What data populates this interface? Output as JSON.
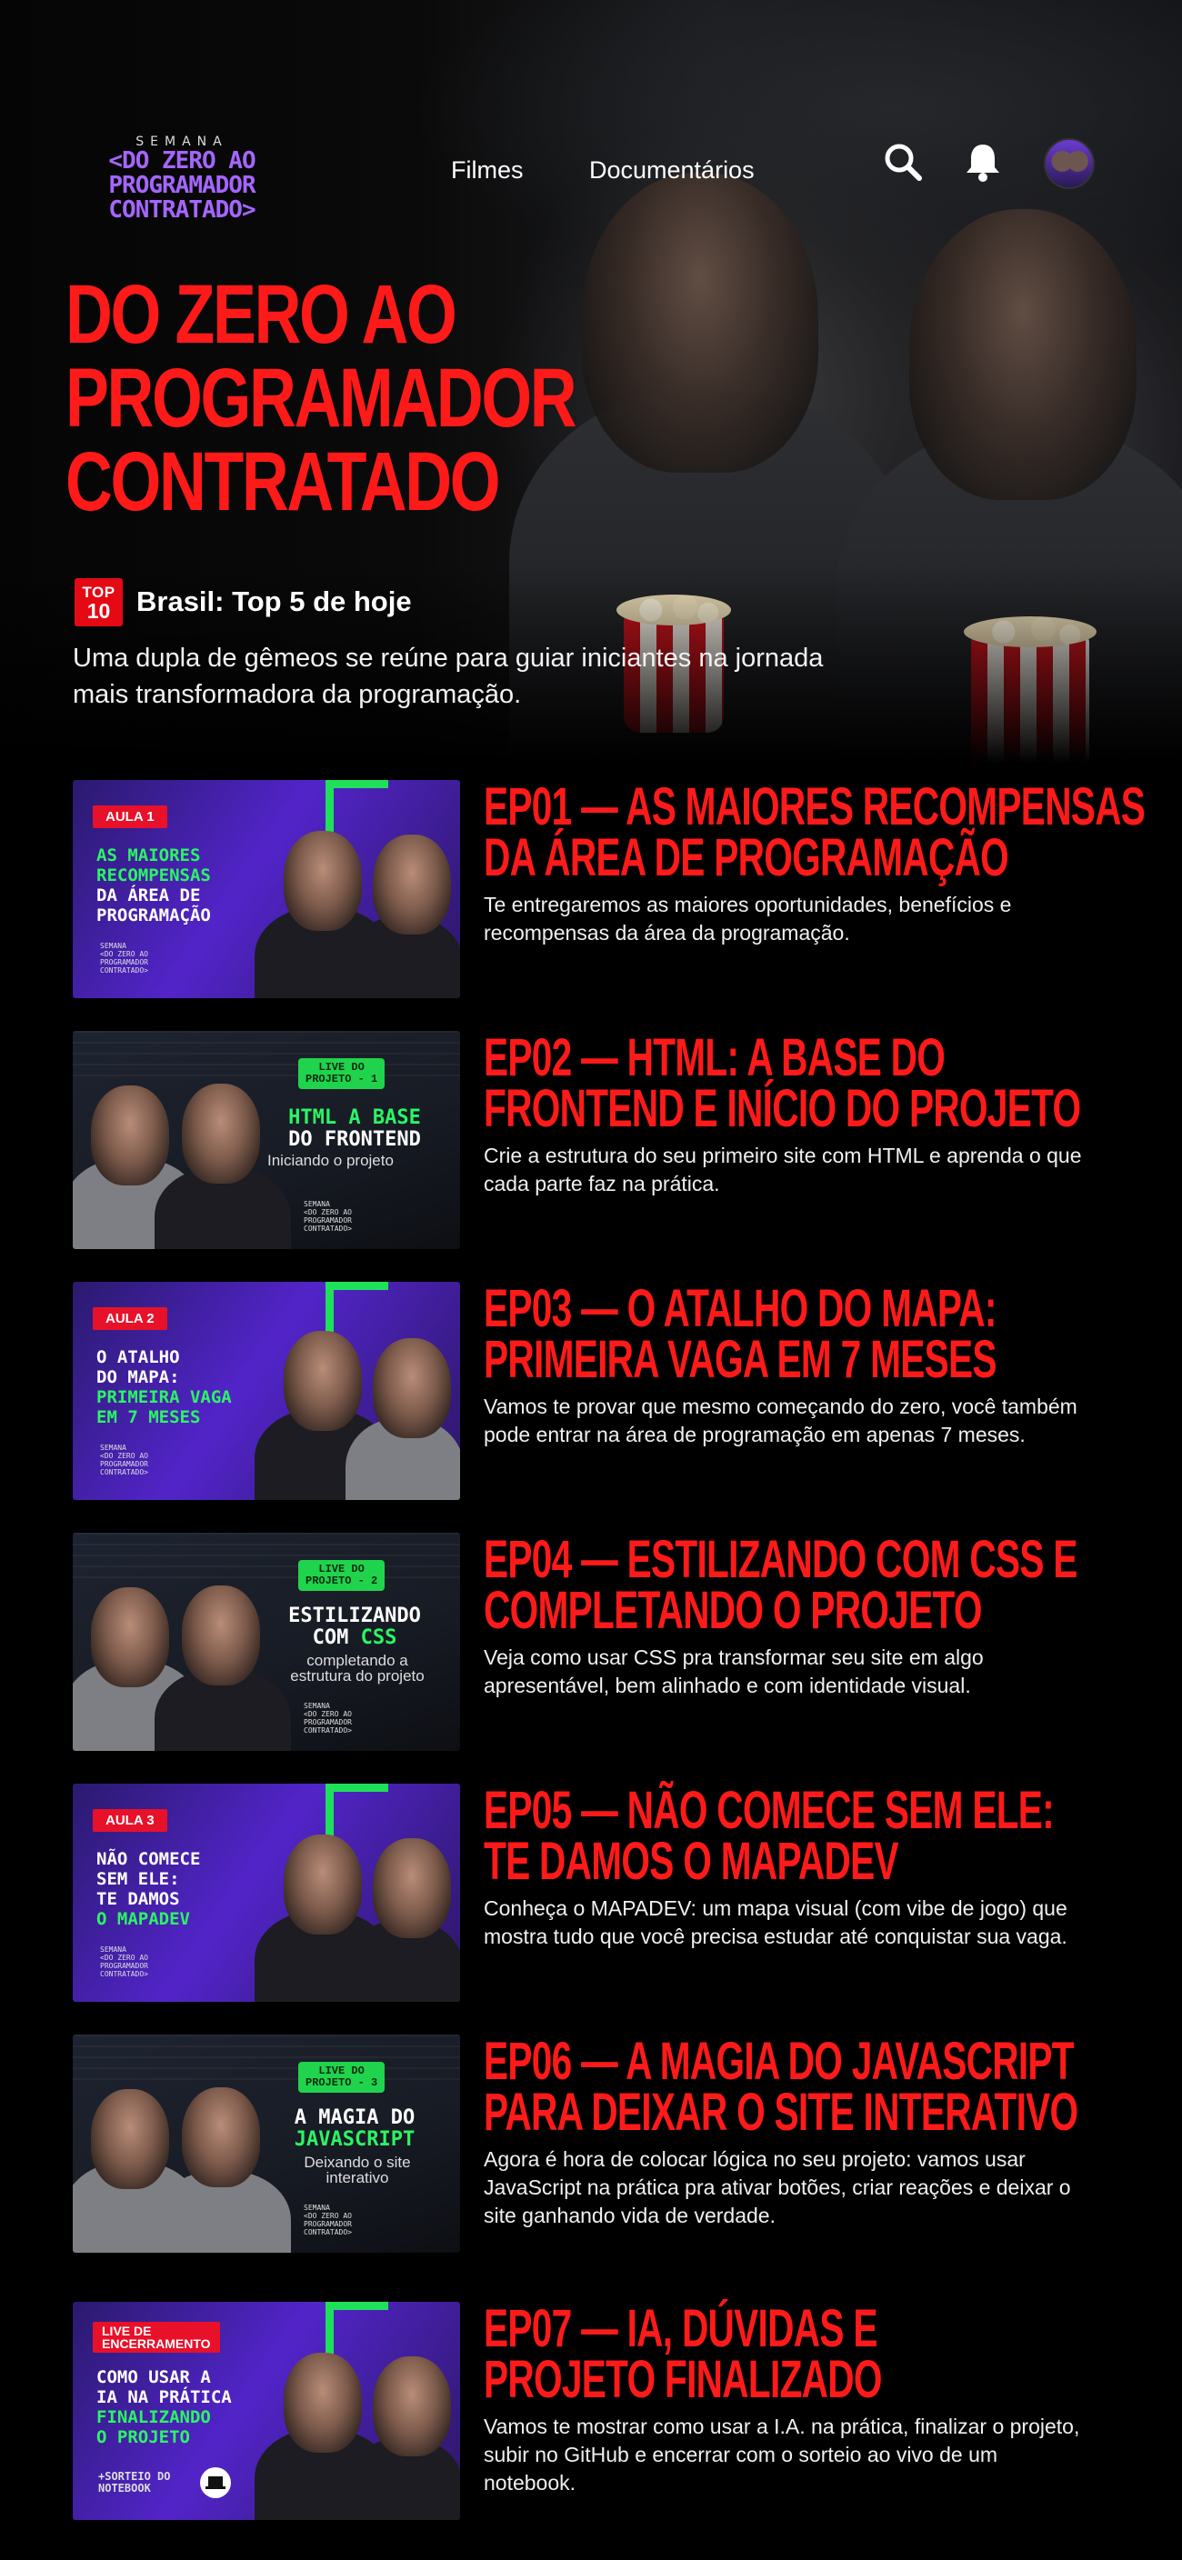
{
  "header": {
    "logo": {
      "top": "SEMANA",
      "line1": "<DO ZERO AO",
      "line2": "PROGRAMADOR",
      "line3": "CONTRATADO>"
    },
    "nav": [
      "Filmes",
      "Documentários"
    ],
    "icons": [
      "search-icon",
      "bell-icon",
      "avatar"
    ]
  },
  "hero": {
    "title_lines": [
      "DO ZERO AO",
      "PROGRAMADOR",
      "CONTRATADO"
    ],
    "badge_top": "TOP",
    "badge_num": "10",
    "rank": "Brasil: Top 5 de hoje",
    "description": "Uma dupla de gêmeos se reúne para guiar iniciantes na jornada mais transformadora da programação."
  },
  "thumb_logo": [
    "SEMANA",
    "<DO ZERO AO",
    "PROGRAMADOR",
    "CONTRATADO>"
  ],
  "episodes": [
    {
      "title_1": "EP01 — AS MAIORES RECOMPENSAS",
      "title_2": "DA ÁREA DE PROGRAMAÇÃO",
      "description": "Te entregaremos as maiores oportunidades, benefícios e recompensas da área da programação.",
      "thumb": {
        "badge": "AULA 1",
        "l1": "AS MAIORES",
        "l2": "RECOMPENSAS",
        "l3": "DA ÁREA DE",
        "l4": "PROGRAMAÇÃO"
      }
    },
    {
      "title_1": "EP02 — HTML: A BASE DO",
      "title_2": "FRONTEND E INÍCIO DO PROJETO",
      "description": "Crie a estrutura do seu primeiro site com HTML e aprenda o que cada parte faz na prática.",
      "thumb": {
        "badge_a": "LIVE DO",
        "badge_b": "PROJETO - 1",
        "l1": "HTML A BASE",
        "l2": "DO FRONTEND",
        "sub": "Iniciando o projeto"
      }
    },
    {
      "title_1": "EP03 — O ATALHO DO MAPA:",
      "title_2": "PRIMEIRA VAGA EM 7 MESES",
      "description": "Vamos te provar que mesmo começando do zero, você também pode entrar na área de programação em apenas 7 meses.",
      "thumb": {
        "badge": "AULA 2",
        "l1": "O ATALHO",
        "l2": "DO MAPA:",
        "l3": "PRIMEIRA VAGA",
        "l4": "EM 7 MESES"
      }
    },
    {
      "title_1": "EP04 — ESTILIZANDO COM CSS E",
      "title_2": "COMPLETANDO O PROJETO",
      "description": "Veja como usar CSS pra transformar seu site em algo apresentável, bem alinhado e com identidade visual.",
      "thumb": {
        "badge_a": "LIVE DO",
        "badge_b": "PROJETO - 2",
        "l1": "ESTILIZANDO",
        "l2a": "COM ",
        "l2b": "CSS",
        "sub1": "completando a",
        "sub2": "estrutura do projeto"
      }
    },
    {
      "title_1": "EP05 — NÃO COMECE SEM ELE:",
      "title_2": "TE DAMOS O MAPADEV",
      "description": "Conheça o MAPADEV: um mapa visual (com vibe de jogo) que mostra tudo que você precisa estudar até conquistar sua vaga.",
      "thumb": {
        "badge": "AULA 3",
        "l1": "NÃO COMECE",
        "l2": "SEM ELE:",
        "l3": "TE DAMOS",
        "l4": "O MAPADEV"
      }
    },
    {
      "title_1": "EP06 — A MAGIA DO JAVASCRIPT",
      "title_2": "PARA DEIXAR O SITE INTERATIVO",
      "description": "Agora é hora de colocar lógica no seu projeto: vamos usar JavaScript na prática pra ativar botões, criar reações e deixar o site ganhando vida de verdade.",
      "thumb": {
        "badge_a": "LIVE DO",
        "badge_b": "PROJETO - 3",
        "l1": "A MAGIA DO",
        "l2": "JAVASCRIPT",
        "sub1": "Deixando o site",
        "sub2": "interativo"
      }
    },
    {
      "title_1": "EP07 —  IA, DÚVIDAS E",
      "title_2": "PROJETO FINALIZADO",
      "description": "Vamos te mostrar como usar a I.A. na prática, finalizar o projeto, subir no GitHub e encerrar com o sorteio ao vivo de um notebook.",
      "thumb": {
        "badge_a": "LIVE DE",
        "badge_b": "ENCERRAMENTO",
        "l1": "COMO USAR A",
        "l2": "IA NA PRÁTICA",
        "l3": "FINALIZANDO",
        "l4": "O PROJETO",
        "note1": "+SORTEIO DO",
        "note2": "NOTEBOOK"
      }
    }
  ]
}
